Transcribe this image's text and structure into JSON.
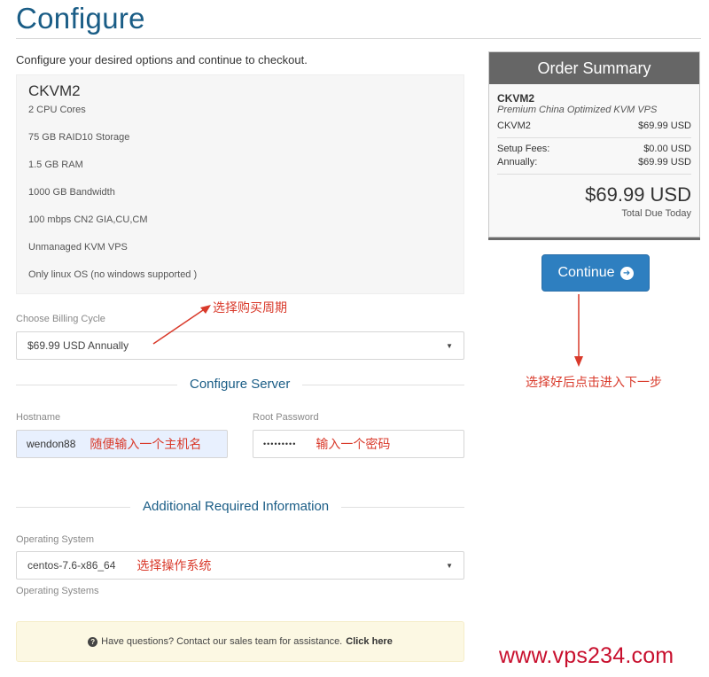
{
  "page": {
    "title": "Configure",
    "intro": "Configure your desired options and continue to checkout."
  },
  "product": {
    "name": "CKVM2",
    "features": [
      "2 CPU Cores",
      "75 GB RAID10 Storage",
      "1.5 GB RAM",
      "1000 GB Bandwidth",
      "100 mbps CN2 GIA,CU,CM",
      "Unmanaged KVM VPS",
      "Only linux OS (no windows supported )"
    ]
  },
  "billing": {
    "label": "Choose Billing Cycle",
    "selected": "$69.99 USD Annually"
  },
  "configure_server": {
    "heading": "Configure Server",
    "hostname_label": "Hostname",
    "hostname_value": "wendon88",
    "password_label": "Root Password",
    "password_value": "•••••••••"
  },
  "additional": {
    "heading": "Additional Required Information",
    "os_label": "Operating System",
    "os_selected": "centos-7.6-x86_64",
    "os_help": "Operating Systems"
  },
  "help": {
    "icon": "question-circle-icon",
    "text": "Have questions? Contact our sales team for assistance.",
    "link": "Click here"
  },
  "summary": {
    "title": "Order Summary",
    "product_name": "CKVM2",
    "product_desc": "Premium China Optimized KVM VPS",
    "line_item_name": "CKVM2",
    "line_item_price": "$69.99 USD",
    "setup_label": "Setup Fees:",
    "setup_value": "$0.00 USD",
    "annual_label": "Annually:",
    "annual_value": "$69.99 USD",
    "total": "$69.99 USD",
    "total_label": "Total Due Today"
  },
  "continue_button": {
    "label": "Continue",
    "icon": "arrow-circle-right-icon"
  },
  "annotations": {
    "billing_note": "选择购买周期",
    "hostname_note": "随便输入一个主机名",
    "password_note": "输入一个密码",
    "os_note": "选择操作系统",
    "continue_note": "选择好后点击进入下一步"
  },
  "watermark": "www.vps234.com",
  "colors": {
    "accent": "#1a5d86",
    "button": "#2e7fc0",
    "annotation": "#d93a2b",
    "watermark": "#c8102e",
    "summary_header": "#666666"
  }
}
